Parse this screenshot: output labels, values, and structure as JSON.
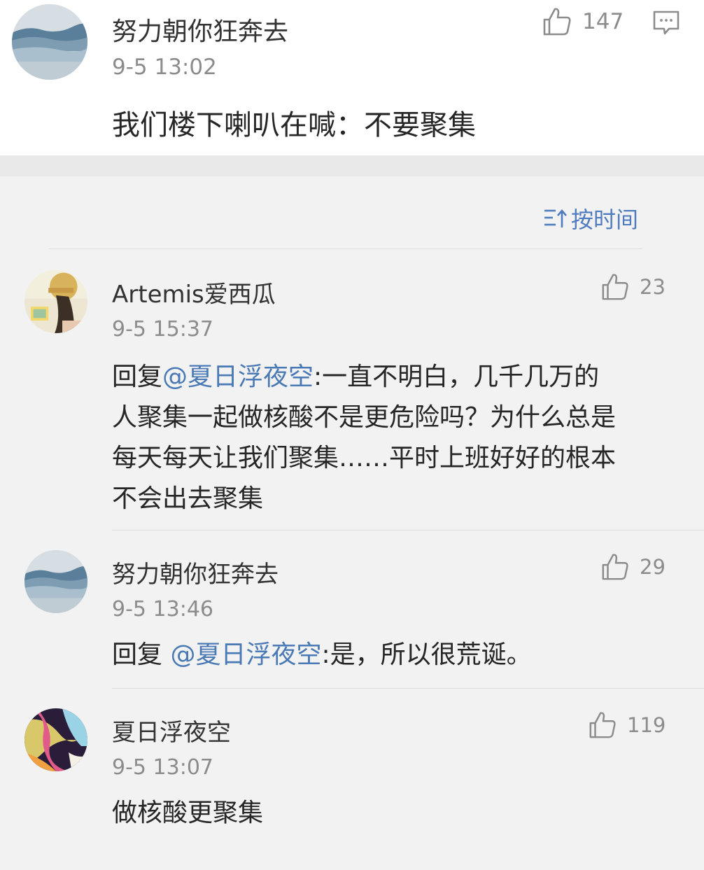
{
  "main_comment": {
    "user": "努力朝你狂奔去",
    "time": "9-5 13:02",
    "likes": "147",
    "text": "我们楼下喇叭在喊：不要聚集",
    "like_icon": "thumbs-up-icon",
    "comment_icon": "comment-icon"
  },
  "sort": {
    "label": "按时间",
    "icon": "sort-icon"
  },
  "replies": [
    {
      "user": "Artemis爱西瓜",
      "time": "9-5 15:37",
      "likes": "23",
      "prefix": "回复",
      "mention": "@夏日浮夜空",
      "lines": [
        ":一直不明白，几千几万的",
        "人聚集一起做核酸不是更危险吗？为什么总是",
        "每天每天让我们聚集……平时上班好好的根本",
        "不会出去聚集"
      ]
    },
    {
      "user": "努力朝你狂奔去",
      "time": "9-5 13:46",
      "likes": "29",
      "prefix": "回复 ",
      "mention": "@夏日浮夜空",
      "text": ":是，所以很荒诞。"
    },
    {
      "user": "夏日浮夜空",
      "time": "9-5 13:07",
      "likes": "119",
      "text": "做核酸更聚集"
    }
  ],
  "colors": {
    "mention": "#4a7ab5",
    "sort": "#4f7cbf",
    "background": "#f2f2f2"
  }
}
